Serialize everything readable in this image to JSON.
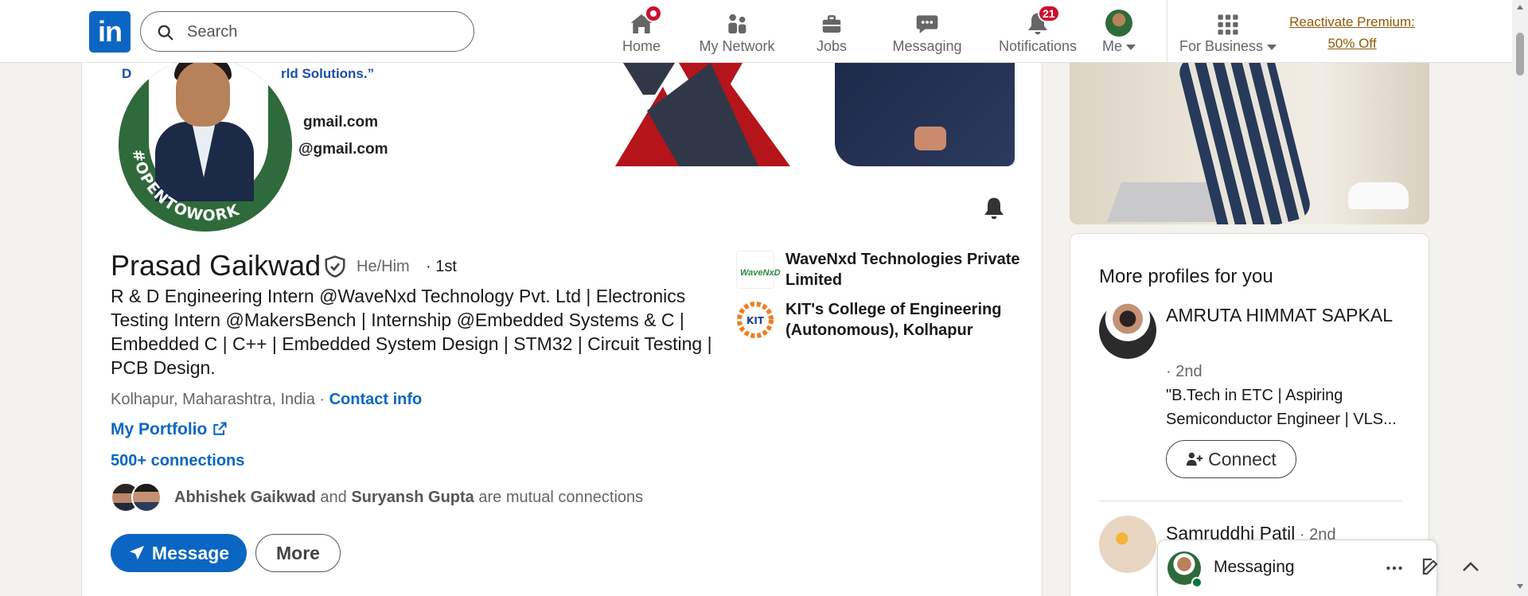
{
  "nav": {
    "logo_text": "in",
    "search_placeholder": "Search",
    "items": [
      {
        "label": "Home",
        "icon": "home-icon"
      },
      {
        "label": "My Network",
        "icon": "people-icon"
      },
      {
        "label": "Jobs",
        "icon": "briefcase-icon"
      },
      {
        "label": "Messaging",
        "icon": "chat-icon"
      },
      {
        "label": "Notifications",
        "icon": "bell-icon",
        "badge": "21"
      },
      {
        "label": "Me",
        "icon": "avatar-icon"
      },
      {
        "label": "For Business",
        "icon": "grid-icon"
      }
    ],
    "premium_line1": "Reactivate Premium:",
    "premium_line2": "50% Off"
  },
  "banner": {
    "quote_start": "D",
    "quote_end": "rld Solutions.”",
    "mail1": "gmail.com",
    "mail2": "@gmail.com",
    "open_to_work": "#OPENTOWORK"
  },
  "profile": {
    "name": "Prasad Gaikwad",
    "pronouns": "He/Him",
    "degree": "· 1st",
    "headline": "R & D Engineering Intern @WaveNxd Technology Pvt. Ltd | Electronics Testing Intern @MakersBench | Internship @Embedded Systems & C | Embedded C | C++ | Embedded System Design | STM32 | Circuit Testing | PCB Design.",
    "location": "Kolhapur, Maharashtra, India",
    "separator": " · ",
    "contact_info": "Contact info",
    "portfolio": "My Portfolio",
    "connections": "500+ connections",
    "mutual_1": "Abhishek Gaikwad",
    "mutual_and": " and ",
    "mutual_2": "Suryansh Gupta",
    "mutual_suffix": " are mutual connections",
    "message_button": "Message",
    "more_button": "More",
    "orgs": [
      {
        "name": "WaveNxd Technologies Private Limited",
        "logo_text": "WaveNxD"
      },
      {
        "name": "KIT's College of Engineering (Autonomous), Kolhapur",
        "logo_text": "KIT"
      }
    ]
  },
  "more_profiles": {
    "title": "More profiles for you",
    "people": [
      {
        "name": "AMRUTA HIMMAT SAPKAL",
        "degree": "· 2nd",
        "headline": "\"B.Tech in ETC | Aspiring Semiconductor Engineer | VLS..."
      },
      {
        "name": "Samruddhi Patil",
        "degree": " · 2nd",
        "headline": ""
      }
    ],
    "connect_label": "Connect"
  },
  "messaging": {
    "title": "Messaging"
  },
  "colors": {
    "brand": "#0a66c2",
    "badge": "#cb112d",
    "premium": "#915907",
    "otw_green": "#2f6a3b",
    "online": "#057642"
  }
}
